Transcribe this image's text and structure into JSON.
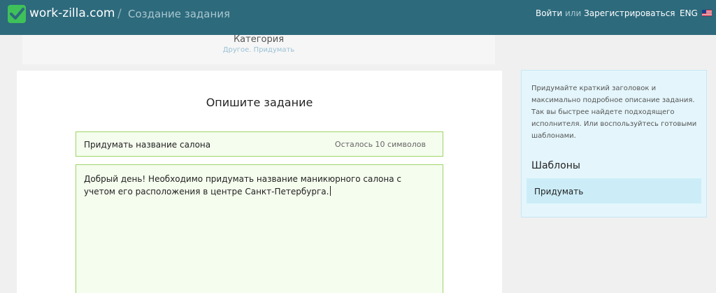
{
  "header": {
    "logo_text": "work-zilla.com",
    "separator": "/",
    "page_heading": "Создание задания",
    "login_label": "Войти",
    "or_label": "или",
    "register_label": "Зарегистрироваться",
    "lang_label": "ENG",
    "logo_icon": "checkmark-icon",
    "flag_icon": "us-flag-icon",
    "colors": {
      "bar": "#2d6a7c",
      "logo_green": "#3fc15a"
    }
  },
  "category": {
    "title": "Категория",
    "subtitle": "Другое. Придумать"
  },
  "form": {
    "heading": "Опишите задание",
    "title_value": "Придумать название салона",
    "title_counter": "Осталось 10 символов",
    "description_value": "Добрый день! Необходимо придумать название маникюрного салона с учетом его расположения в центре Санкт-Петербурга.",
    "colors": {
      "field_border": "#9ed468",
      "field_bg": "#f5fdee"
    }
  },
  "sidebar": {
    "hint": "Придумайте краткий заголовок и максимально подробное описание задания. Так вы быстрее найдете подходящего исполнителя. Или воспользуйтесь готовыми шаблонами.",
    "templates_heading": "Шаблоны",
    "templates": [
      {
        "label": "Придумать"
      }
    ]
  }
}
